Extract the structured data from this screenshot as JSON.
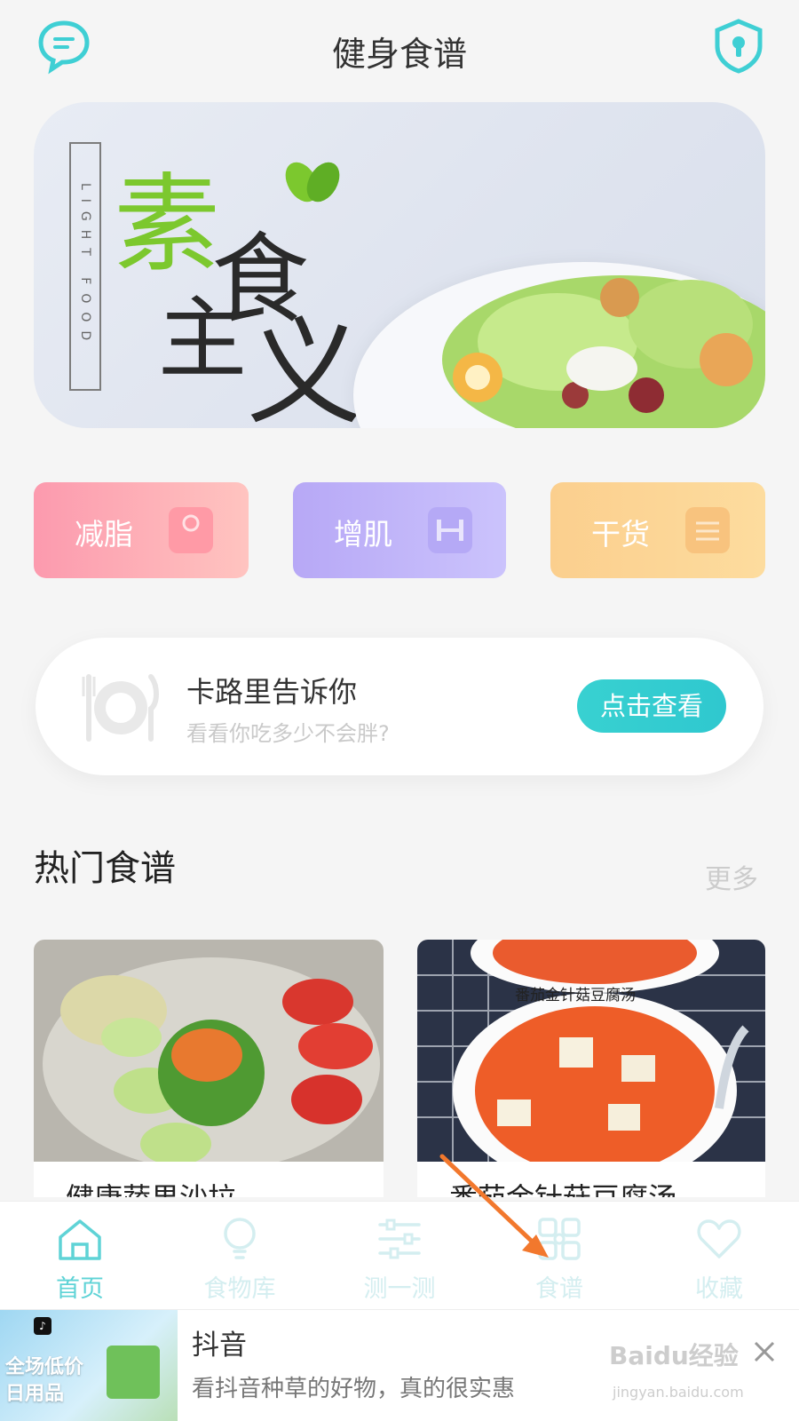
{
  "header": {
    "title": "健身食谱"
  },
  "banner": {
    "vertical_tag": "LIGHT FOOD",
    "chars": {
      "su": "素",
      "shi": "食",
      "zhu": "主",
      "yi": "义"
    }
  },
  "categories": [
    {
      "label": "减脂",
      "color": "#fc9aae"
    },
    {
      "label": "增肌",
      "color": "#b7a8f6"
    },
    {
      "label": "干货",
      "color": "#fbcf8e"
    }
  ],
  "calorie_card": {
    "title": "卡路里告诉你",
    "subtitle": "看看你吃多少不会胖?",
    "button": "点击查看"
  },
  "hot_section": {
    "title": "热门食谱",
    "more": "更多"
  },
  "recipes": [
    {
      "caption": "健康蔬果沙拉"
    },
    {
      "caption": "番茄金针菇豆腐汤",
      "overlay": "番茄金针菇豆腐汤"
    }
  ],
  "bottom_nav": [
    {
      "label": "首页",
      "icon": "home-icon",
      "active": true
    },
    {
      "label": "食物库",
      "icon": "lightbulb-icon",
      "active": false
    },
    {
      "label": "测一测",
      "icon": "sliders-icon",
      "active": false
    },
    {
      "label": "食谱",
      "icon": "grid-icon",
      "active": false
    },
    {
      "label": "收藏",
      "icon": "heart-icon",
      "active": false
    }
  ],
  "ad": {
    "title": "抖音",
    "desc": "看抖音种草的好物，真的很实惠",
    "image_text_1": "全场低价",
    "image_text_2": "日用品",
    "badge": "♪"
  },
  "watermark": {
    "main": "Baidu经验",
    "sub": "jingyan.baidu.com"
  },
  "colors": {
    "accent": "#5fd3d6",
    "button": "#38d1d1"
  }
}
